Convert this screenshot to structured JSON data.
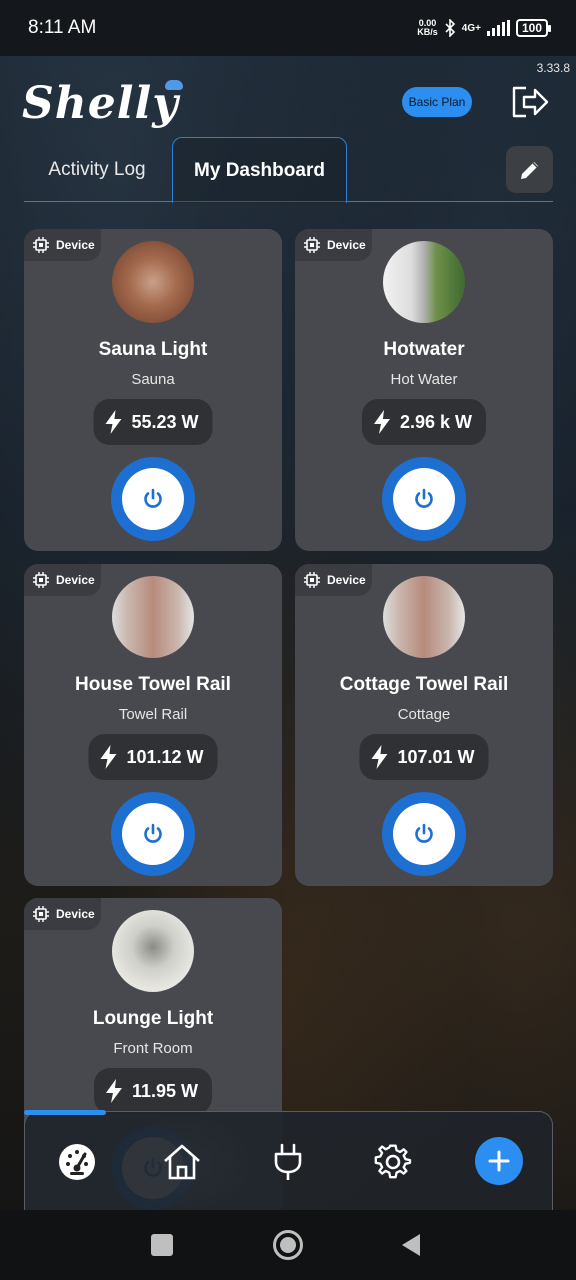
{
  "status_bar": {
    "time": "8:11 AM",
    "net_speed_value": "0.00",
    "net_speed_unit": "KB/s",
    "network": "4G+",
    "battery": "100"
  },
  "app": {
    "version": "3.33.8",
    "logo": "Shelly",
    "plan_label": "Basic Plan",
    "accent_color": "#2b8ef0"
  },
  "tabs": [
    {
      "label": "Activity Log",
      "active": false
    },
    {
      "label": "My Dashboard",
      "active": true
    }
  ],
  "cards": [
    {
      "tag": "Device",
      "name": "Sauna Light",
      "room": "Sauna",
      "power": "55.23 W",
      "photo": "sauna-photo"
    },
    {
      "tag": "Device",
      "name": "Hotwater",
      "room": "Hot Water",
      "power": "2.96 k W",
      "photo": "hotwater-photo"
    },
    {
      "tag": "Device",
      "name": "House Towel Rail",
      "room": "Towel Rail",
      "power": "101.12 W",
      "photo": "towel-rail-photo"
    },
    {
      "tag": "Device",
      "name": "Cottage Towel Rail",
      "room": "Cottage",
      "power": "107.01 W",
      "photo": "towel-rail-photo"
    },
    {
      "tag": "Device",
      "name": "Lounge Light",
      "room": "Front Room",
      "power": "11.95 W",
      "photo": "ceiling-light-photo"
    }
  ],
  "bottom_nav": [
    {
      "icon": "dashboard-gauge-icon",
      "active": true
    },
    {
      "icon": "home-icon",
      "active": false
    },
    {
      "icon": "plug-icon",
      "active": false
    },
    {
      "icon": "settings-gear-icon",
      "active": false
    },
    {
      "icon": "add-icon",
      "active": false
    }
  ]
}
